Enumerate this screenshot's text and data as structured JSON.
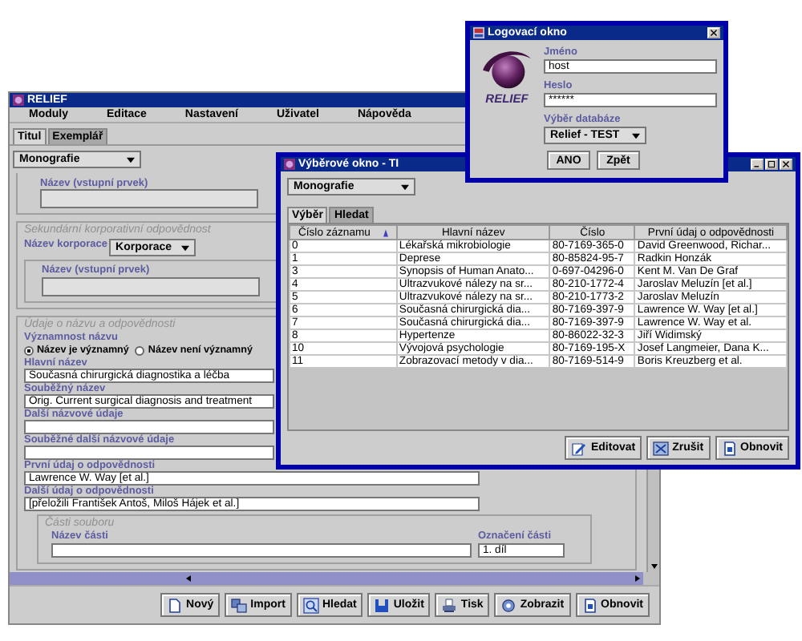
{
  "main_window": {
    "title": "RELIEF",
    "menu": [
      "Moduly",
      "Editace",
      "Nastavení",
      "Uživatel",
      "Nápověda"
    ],
    "tabs": [
      {
        "label": "Titul",
        "selected": true
      },
      {
        "label": "Exemplář",
        "selected": false
      }
    ],
    "record_type": "Monografie",
    "top_group": {
      "field_label": "Název (vstupní prvek)"
    },
    "corporate_group": {
      "title": "Sekundární korporativní odpovědnost",
      "name_label": "Název korporace",
      "name_value": "Korporace",
      "field_label": "Název (vstupní prvek)"
    },
    "title_group": {
      "title": "Údaje o názvu a odpovědnosti",
      "significance_label": "Významnost názvu",
      "radios": [
        {
          "label": "Název je významný",
          "selected": true
        },
        {
          "label": "Název není významný",
          "selected": false
        }
      ],
      "fields": [
        {
          "label": "Hlavní název",
          "value": "Současná chirurgická diagnostika a léčba"
        },
        {
          "label": "Souběžný název",
          "value": "Orig. Current surgical diagnosis and treatment"
        },
        {
          "label": "Další názvové údaje"
        },
        {
          "label": "Souběžné další názvové údaje"
        },
        {
          "label": "První údaj o odpovědnosti",
          "value": "Lawrence W. Way [et al.]"
        },
        {
          "label": "Další údaj o odpovědnosti",
          "value": "[přeložili František Antoš, Miloš Hájek et al.]"
        }
      ],
      "parts_group": {
        "title": "Části souboru",
        "part_name_label": "Název části",
        "part_number_label": "Označení části",
        "part_number_value": "1. díl"
      }
    },
    "buttons": [
      "Nový",
      "Import",
      "Hledat",
      "Uložit",
      "Tisk",
      "Zobrazit",
      "Obnovit"
    ]
  },
  "selection_window": {
    "title": "Výběrové okno - TI",
    "record_type": "Monografie",
    "tabs": [
      {
        "label": "Výběr",
        "selected": true
      },
      {
        "label": "Hledat",
        "selected": false
      }
    ],
    "table": {
      "columns": [
        "Číslo záznamu",
        "Hlavní název",
        "Číslo",
        "První údaj o odpovědnosti"
      ],
      "rows": [
        [
          "0",
          "Lékařská mikrobiologie",
          "80-7169-365-0",
          "David Greenwood, Richar..."
        ],
        [
          "1",
          "Deprese",
          "80-85824-95-7",
          "Radkin Honzák"
        ],
        [
          "3",
          "Synopsis of Human Anato...",
          "0-697-04296-0",
          "Kent M. Van De Graf"
        ],
        [
          "4",
          "Ultrazvukové nálezy na sr...",
          "80-210-1772-4",
          "Jaroslav Meluzín [et al.]"
        ],
        [
          "5",
          "Ultrazvukové nálezy na sr...",
          "80-210-1773-2",
          "Jaroslav Meluzín"
        ],
        [
          "6",
          "Současná chirurgická dia...",
          "80-7169-397-9",
          "Lawrence W. Way [et al.]"
        ],
        [
          "7",
          "Současná chirurgická dia...",
          "80-7169-397-9",
          "Lawrence W. Way et al."
        ],
        [
          "8",
          "Hypertenze",
          "80-86022-32-3",
          "Jiří Widimský"
        ],
        [
          "10",
          "Vývojová psychologie",
          "80-7169-195-X",
          "Josef Langmeier, Dana K..."
        ],
        [
          "11",
          "Zobrazovací metody v dia...",
          "80-7169-514-9",
          "Boris  Kreuzberg et al."
        ]
      ]
    },
    "buttons": [
      "Editovat",
      "Zrušit",
      "Obnovit"
    ]
  },
  "login_window": {
    "title": "Logovací okno",
    "logo_text": "RELIEF",
    "username_label": "Jméno",
    "username": "host",
    "password_label": "Heslo",
    "password": "******",
    "database_label": "Výběr databáze",
    "database": "Relief - TEST",
    "buttons": [
      "ANO",
      "Zpět"
    ]
  }
}
